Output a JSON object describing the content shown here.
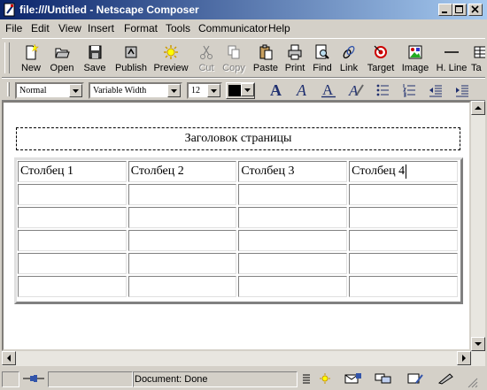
{
  "window": {
    "title": "file:///Untitled - Netscape Composer"
  },
  "menu": [
    "File",
    "Edit",
    "View",
    "Insert",
    "Format",
    "Tools",
    "Communicator",
    "Help"
  ],
  "toolbar": {
    "buttons": [
      {
        "label": "New",
        "icon": "new-page-icon",
        "enabled": true
      },
      {
        "label": "Open",
        "icon": "open-folder-icon",
        "enabled": true
      },
      {
        "label": "Save",
        "icon": "floppy-disk-icon",
        "enabled": true
      },
      {
        "label": "Publish",
        "icon": "publish-icon",
        "enabled": true
      },
      {
        "label": "Preview",
        "icon": "preview-icon",
        "enabled": true
      },
      {
        "label": "Cut",
        "icon": "scissors-icon",
        "enabled": false
      },
      {
        "label": "Copy",
        "icon": "copy-icon",
        "enabled": false
      },
      {
        "label": "Paste",
        "icon": "paste-icon",
        "enabled": true
      },
      {
        "label": "Print",
        "icon": "printer-icon",
        "enabled": true
      },
      {
        "label": "Find",
        "icon": "find-icon",
        "enabled": true
      },
      {
        "label": "Link",
        "icon": "link-icon",
        "enabled": true
      },
      {
        "label": "Target",
        "icon": "target-icon",
        "enabled": true
      },
      {
        "label": "Image",
        "icon": "image-icon",
        "enabled": true
      },
      {
        "label": "H. Line",
        "icon": "horizontal-line-icon",
        "enabled": true
      },
      {
        "label": "Ta",
        "icon": "table-icon",
        "enabled": true
      }
    ]
  },
  "format_toolbar": {
    "paragraph_style": "Normal",
    "font_face": "Variable Width",
    "font_size": "12",
    "text_color": "#000000"
  },
  "document": {
    "heading": "Заголовок страницы",
    "table": {
      "header": [
        "Столбец 1",
        "Столбец 2",
        "Столбец 3",
        "Столбец 4"
      ],
      "empty_rows": 5
    }
  },
  "status": {
    "text": "Document: Done"
  },
  "colors": {
    "title_start": "#0a246a",
    "title_end": "#a6caf0",
    "chrome": "#d4d0c8"
  }
}
